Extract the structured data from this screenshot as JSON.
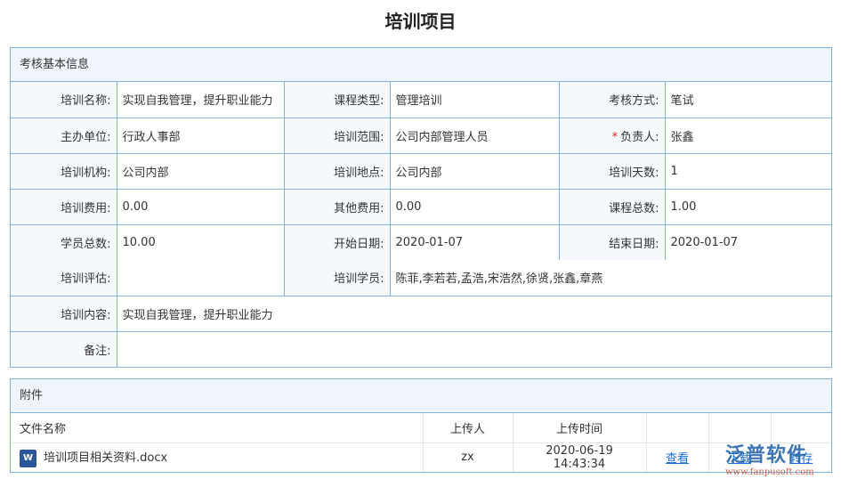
{
  "title": "培训项目",
  "basic": {
    "header": "考核基本信息",
    "rows": [
      [
        {
          "label": "培训名称:",
          "value": "实现自我管理，提升职业能力"
        },
        {
          "label": "课程类型:",
          "value": "管理培训"
        },
        {
          "label": "考核方式:",
          "value": "笔试"
        }
      ],
      [
        {
          "label": "主办单位:",
          "value": "行政人事部"
        },
        {
          "label": "培训范围:",
          "value": "公司内部管理人员"
        },
        {
          "label": "负责人:",
          "value": "张鑫",
          "required": "*"
        }
      ],
      [
        {
          "label": "培训机构:",
          "value": "公司内部"
        },
        {
          "label": "培训地点:",
          "value": "公司内部"
        },
        {
          "label": "培训天数:",
          "value": "1"
        }
      ],
      [
        {
          "label": "培训费用:",
          "value": "0.00"
        },
        {
          "label": "其他费用:",
          "value": "0.00"
        },
        {
          "label": "课程总数:",
          "value": "1.00"
        }
      ],
      [
        {
          "label": "学员总数:",
          "value": "10.00"
        },
        {
          "label": "开始日期:",
          "value": "2020-01-07"
        },
        {
          "label": "结束日期:",
          "value": "2020-01-07"
        }
      ]
    ],
    "eval_label": "培训评估:",
    "eval_value": "",
    "trainees_label": "培训学员:",
    "trainees_value": "陈菲,李若若,孟浩,宋浩然,徐贤,张鑫,章燕",
    "content_label": "培训内容:",
    "content_value": "实现自我管理，提升职业能力",
    "remark_label": "备注:",
    "remark_value": ""
  },
  "attachments": {
    "header": "附件",
    "columns": [
      "文件名称",
      "上传人",
      "上传时间"
    ],
    "files": [
      {
        "name": "培训项目相关资料.docx",
        "uploader": "zx",
        "time": "2020-06-19 14:43:34",
        "view": "查看",
        "download": "下载",
        "save": "转存"
      }
    ]
  },
  "watermark": {
    "text": "泛普软件",
    "url": "www.fanpusoft.com"
  }
}
